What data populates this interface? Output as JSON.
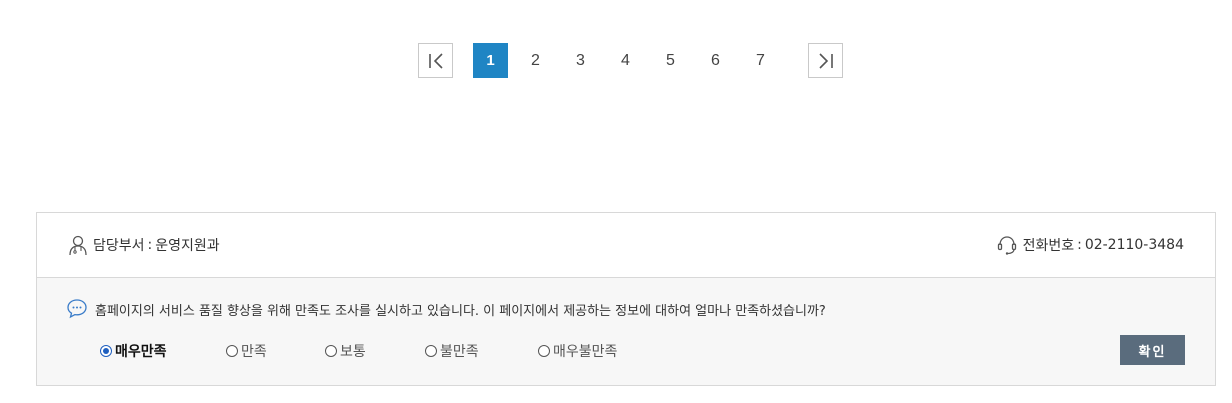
{
  "pagination": {
    "first_icon": "first-page-icon",
    "last_icon": "last-page-icon",
    "pages": [
      "1",
      "2",
      "3",
      "4",
      "5",
      "6",
      "7"
    ],
    "current": "1"
  },
  "contact": {
    "dept_label": "담당부서",
    "dept_value": "운영지원과",
    "phone_label": "전화번호",
    "phone_value": "02-2110-3484",
    "person_icon": "person-icon",
    "headset_icon": "headset-icon"
  },
  "survey": {
    "chat_icon": "chat-bubble-icon",
    "question": "홈페이지의 서비스 품질 향상을 위해 만족도 조사를 실시하고 있습니다. 이 페이지에서 제공하는 정보에 대하여 얼마나 만족하셨습니까?",
    "options": [
      "매우만족",
      "만족",
      "보통",
      "불만족",
      "매우불만족"
    ],
    "selected": "매우만족",
    "confirm_label": "확인"
  },
  "colors": {
    "active_page": "#1f85c4",
    "confirm_button": "#5a6c7d",
    "survey_bg": "#f7f7f7"
  }
}
